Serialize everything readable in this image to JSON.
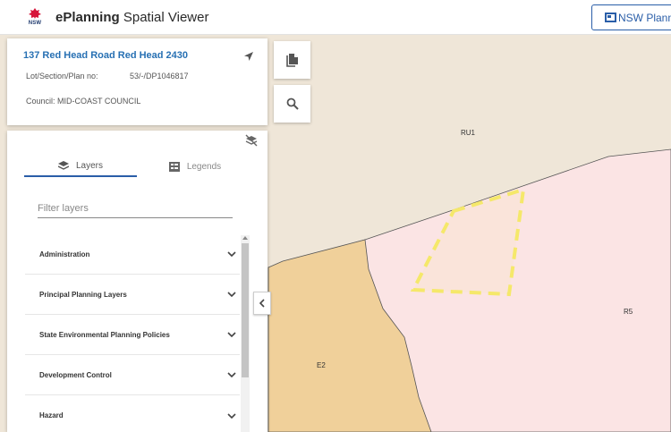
{
  "header": {
    "logo_text": "NSW",
    "title_bold": "ePlanning",
    "title_rest": " Spatial Viewer",
    "nsw_button_label": "NSW Planning"
  },
  "property": {
    "address": "137 Red Head Road Red Head 2430",
    "lot_label": "Lot/Section/Plan no:",
    "lot_value": "53/-/DP1046817",
    "council": "Council: MID-COAST COUNCIL"
  },
  "panel": {
    "tabs": [
      {
        "label": "Layers",
        "icon": "layers-icon",
        "active": true
      },
      {
        "label": "Legends",
        "icon": "legend-icon",
        "active": false
      }
    ],
    "filter_placeholder": "Filter layers",
    "filter_value": "",
    "groups": [
      {
        "label": "Administration"
      },
      {
        "label": "Principal Planning Layers"
      },
      {
        "label": "State Environmental Planning Policies"
      },
      {
        "label": "Development Control"
      },
      {
        "label": "Hazard"
      }
    ]
  },
  "map": {
    "zones": [
      {
        "code": "RU1",
        "color": "#efe6d8"
      },
      {
        "code": "R5",
        "color": "#fbe4e4"
      },
      {
        "code": "E2",
        "color": "#f0d09a"
      }
    ],
    "selected_boundary_color": "#f5e86a"
  }
}
